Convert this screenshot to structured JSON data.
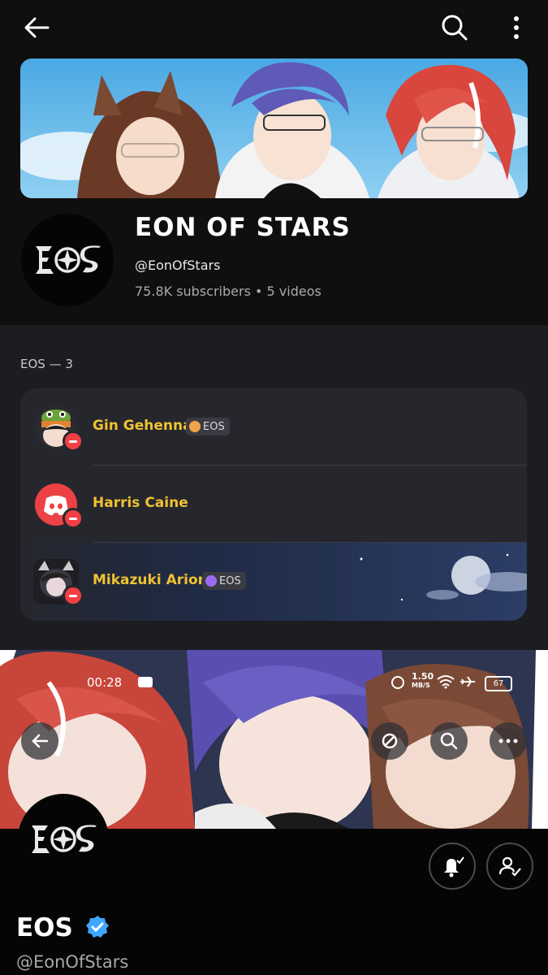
{
  "channel": {
    "title": "EON OF STARS",
    "handle": "@EonOfStars",
    "meta": "75.8K subscribers • 5 videos",
    "logo_text": "EOS"
  },
  "group": {
    "label": "EOS — 3",
    "members": [
      {
        "name": "Gin Gehenna",
        "tag": "EOS",
        "tag_color": "#f2a24a",
        "status": "dnd"
      },
      {
        "name": "Harris Caine",
        "tag": "",
        "status": "dnd"
      },
      {
        "name": "Mikazuki Arion",
        "tag": "EOS",
        "tag_color": "#9b6cf2",
        "status": "dnd"
      }
    ]
  },
  "screenshot": {
    "time": "00:28",
    "speed": "1.50",
    "speed_unit": "MB/S",
    "battery": "67"
  },
  "profile": {
    "name": "EOS",
    "handle": "@EonOfStars",
    "logo_text": "EOS",
    "verified": true
  },
  "colors": {
    "name_gold": "#f0c232",
    "dnd_red": "#f23f43",
    "discord_red": "#ed4245",
    "verified_blue": "#3ea6ff"
  }
}
